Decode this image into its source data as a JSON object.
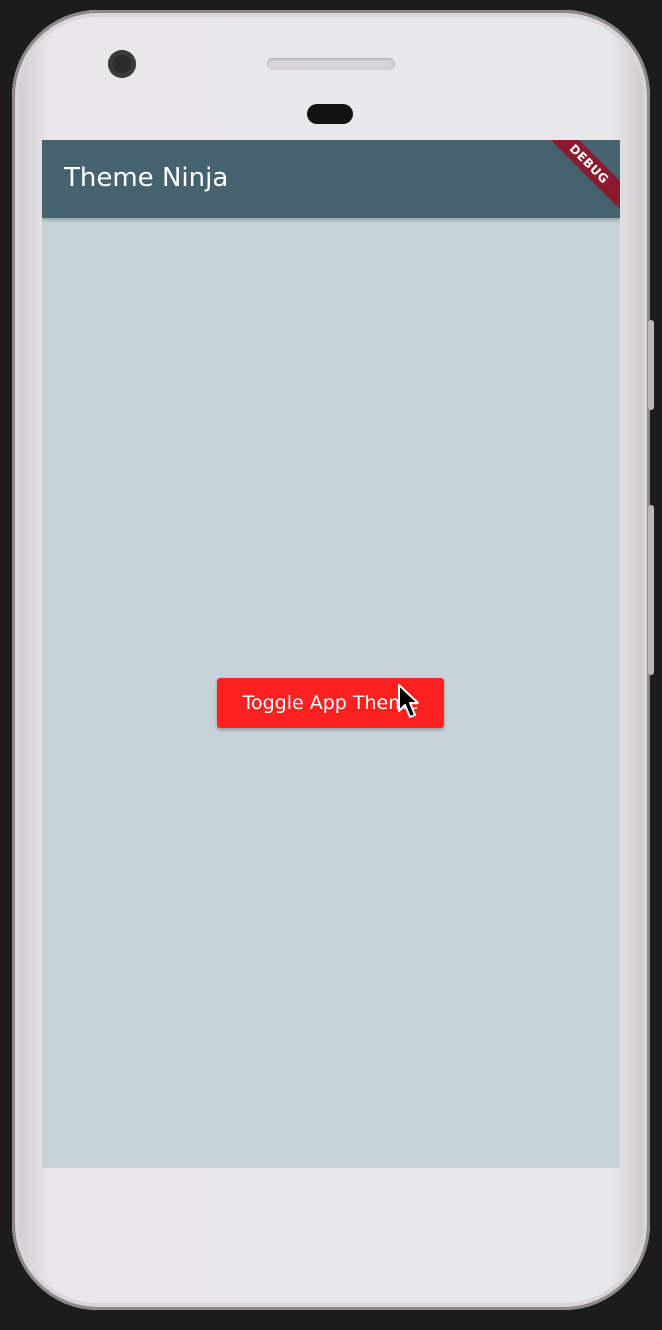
{
  "app": {
    "title": "Theme Ninja",
    "debug_banner": "DEBUG"
  },
  "main": {
    "toggle_button_label": "Toggle App Theme"
  },
  "colors": {
    "app_bar": "#46626f",
    "screen_background": "#c6d2d8",
    "button": "#ff2020",
    "debug_banner": "#8b1a2f"
  },
  "icons": {
    "cursor": "mouse-pointer-icon"
  }
}
